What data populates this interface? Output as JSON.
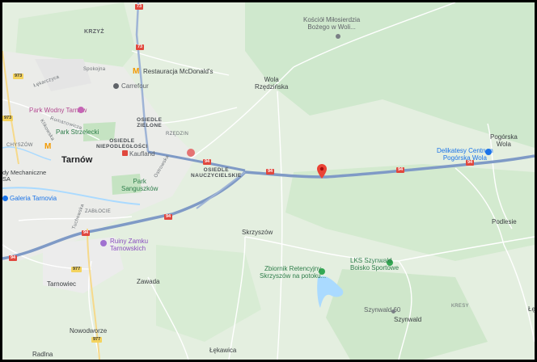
{
  "map": {
    "towns": {
      "tarnow": "Tarnów",
      "wola_rzedzinska": "Wola\nRzędzińska",
      "skrzyszow": "Skrzyszów",
      "pogorska_wola": "Pogórska\nWola",
      "podlesie": "Podlesie",
      "zawada": "Zawada",
      "tarnowiec": "Tarnowiec",
      "nowodworze": "Nowodworze",
      "radlna": "Radlna",
      "szynwald": "Szynwald",
      "lekawica": "Łękawica",
      "krzyz": "KRZYŻ",
      "edge_left": "dy Mechaniczne\nSA",
      "edge_right": "Łę"
    },
    "districts": {
      "osiedle_zielone": "OSIEDLE\nZIELONE",
      "osiedle_niepodleglosci": "OSIEDLE\nNIEPODLEGŁOŚCI",
      "osiedle_nauczycielskie": "OSIEDLE\nNAUCZYCIELSKIE",
      "rzedzin": "RZĘDZIN",
      "zablocie": "ZABŁOCIE",
      "chyszow": "CHYSZÓW",
      "kresy": "KRESY",
      "spokojna": "Spokojna",
      "lekarczyca": "Łękarczyca",
      "romanowicza": "Romanowicza",
      "klikowska": "Klikowska",
      "tuchowska": "Tuchowska",
      "ostrowska": "Ostrowska"
    },
    "pois": {
      "kosciol": "Kościół Miłosierdzia\nBożego w Woli...",
      "mcdonalds": "Restauracja McDonald's",
      "carrefour": "Carrefour",
      "park_wodny": "Park Wodny Tarnów",
      "park_strzelecki": "Park Strzelecki",
      "kaufland": "Kaufland",
      "park_sanguszkow": "Park\nSanguszków",
      "galeria": "Galeria Tarnovia",
      "ruiny": "Ruiny Zamku\nTarnowskich",
      "zbiornik": "Zbiornik Retencyjny\nSkrzyszów na potoku...",
      "lks": "LKS Szynwald\nBoisko Sportowe",
      "delikatesy": "Delikatesy Centrum\nPogórska Wola",
      "szynwald60": "Szynwald 60"
    },
    "shields": {
      "a4_east": "94",
      "a4_mid": "94",
      "a4_mid2": "94",
      "a4_center": "94",
      "a4_west": "94",
      "a4_far": "94",
      "r73": "73",
      "r73b": "73",
      "r973": "973",
      "r973b": "973",
      "r977": "977",
      "r977b": "977"
    },
    "colors": {
      "land": "#e4efe0",
      "forest": "#c8e6c9",
      "highway": "#8ea8cf",
      "urban": "#ececec",
      "water": "#aadaff",
      "pin": "#ea4335"
    },
    "pin_label": "selected-location"
  }
}
